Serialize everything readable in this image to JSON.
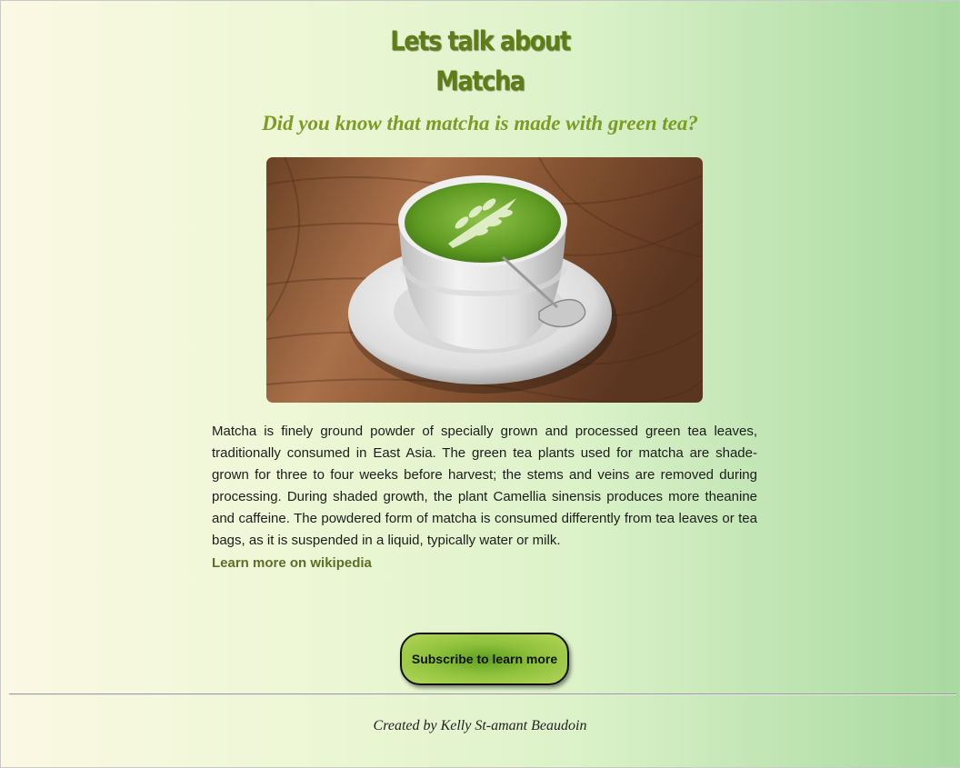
{
  "header": {
    "title_line1": "Lets talk about",
    "title_line2": "Matcha",
    "subtitle": "Did you know that matcha is made with green tea?"
  },
  "image": {
    "description_icon": "matcha-latte-photo"
  },
  "content": {
    "paragraph": "Matcha is finely ground powder of specially grown and processed green tea leaves, traditionally consumed in East Asia. The green tea plants used for matcha are shade-grown for three to four weeks before harvest; the stems and veins are removed during processing. During shaded growth, the plant Camellia sinensis produces more theanine and caffeine. The powdered form of matcha is consumed differently from tea leaves or tea bags, as it is suspended in a liquid, typically water or milk.",
    "link_label": "Learn more on wikipedia"
  },
  "cta": {
    "subscribe_label": "Subscribe to learn more"
  },
  "footer": {
    "credit": "Created by Kelly St-amant Beaudoin"
  },
  "colors": {
    "title": "#5f7d16",
    "subtitle": "#7d9b26",
    "link": "#5f6d28",
    "button_center": "#5fa222",
    "button_edge": "#b3d65a"
  }
}
